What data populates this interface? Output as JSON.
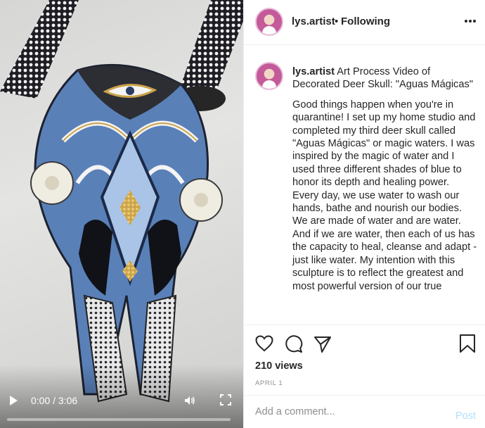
{
  "video": {
    "time": "0:00 / 3:06",
    "progress": 0.0,
    "icons": {
      "play": "play-icon",
      "volume": "volume-icon",
      "fullscreen": "fullscreen-icon"
    }
  },
  "header": {
    "username": "lys.artist",
    "separator": "•",
    "follow_status": "Following",
    "more_icon": "more-options-icon"
  },
  "caption": {
    "username": "lys.artist",
    "title": "Art Process Video of Decorated Deer Skull: \"Aguas Mágicas\"",
    "body": "Good things happen when you're in quarantine! I set up my home studio and completed my third deer skull called \"Aguas Mágicas\" or magic waters. I was inspired by the magic of water and I used three different shades of blue to honor its depth and healing power. Every day, we use water to wash our hands, bathe and nourish our bodies. We are made of water and are water. And if we are water, then each of us has the capacity to heal, cleanse and adapt - just like water. My intention with this sculpture is to reflect the greatest and most powerful version of our true"
  },
  "actions": {
    "icons": [
      "heart-icon",
      "comment-icon",
      "share-icon",
      "bookmark-icon"
    ],
    "views": "210 views",
    "date": "APRIL 1"
  },
  "add_comment": {
    "placeholder": "Add a comment...",
    "post_label": "Post"
  },
  "colors": {
    "accent_disabled": "#b2dffc",
    "muted": "#8e8e8e",
    "text": "#262626"
  }
}
